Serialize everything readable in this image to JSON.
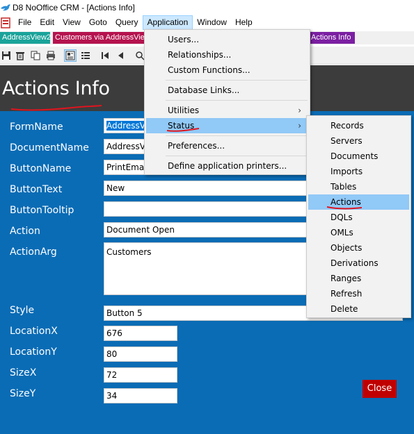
{
  "window": {
    "title": "D8 NoOffice CRM - [Actions Info]"
  },
  "menubar": {
    "items": [
      "File",
      "Edit",
      "View",
      "Goto",
      "Query",
      "Application",
      "Window",
      "Help"
    ],
    "active": "Application"
  },
  "tabs": [
    {
      "label": "AddressView2",
      "color": "#1aa39a"
    },
    {
      "label": "Customers via AddressView",
      "color": "#b5134e"
    },
    {
      "label": "Actions Info",
      "color": "#7b1fa2"
    }
  ],
  "toolbar": {
    "icons": [
      "save-icon",
      "delete-icon",
      "copy-icon",
      "print-icon",
      "form-view-icon",
      "list-view-icon",
      "first-record-icon",
      "previous-record-icon",
      "search-icon"
    ]
  },
  "page": {
    "title": "Actions Info"
  },
  "form": {
    "fields": [
      {
        "label": "FormName",
        "value": "AddressV"
      },
      {
        "label": "DocumentName",
        "value": "AddressV"
      },
      {
        "label": "ButtonName",
        "value": "PrintEmai"
      },
      {
        "label": "ButtonText",
        "value": "New"
      },
      {
        "label": "ButtonTooltip",
        "value": ""
      },
      {
        "label": "Action",
        "value": "Document Open"
      },
      {
        "label": "ActionArg",
        "value": "Customers"
      },
      {
        "label": "Style",
        "value": "Button 5"
      },
      {
        "label": "LocationX",
        "value": "676"
      },
      {
        "label": "LocationY",
        "value": "80"
      },
      {
        "label": "SizeX",
        "value": "72"
      },
      {
        "label": "SizeY",
        "value": "34"
      }
    ],
    "close_label": "Close"
  },
  "application_menu": {
    "items": [
      "Users...",
      "Relationships...",
      "Custom Functions...",
      "Database Links...",
      "Utilities",
      "Status",
      "Preferences...",
      "Define application printers..."
    ],
    "highlighted": "Status"
  },
  "status_submenu": {
    "items": [
      "Records",
      "Servers",
      "Documents",
      "Imports",
      "Tables",
      "Actions",
      "DQLs",
      "OMLs",
      "Objects",
      "Derivations",
      "Ranges",
      "Refresh",
      "Delete"
    ],
    "highlighted": "Actions"
  },
  "colors": {
    "form_background": "#0a6cb5",
    "header_background": "#3c3c3c",
    "menu_highlight": "#91c9f7",
    "close_button": "#c00000",
    "annotation": "#e0141e"
  }
}
